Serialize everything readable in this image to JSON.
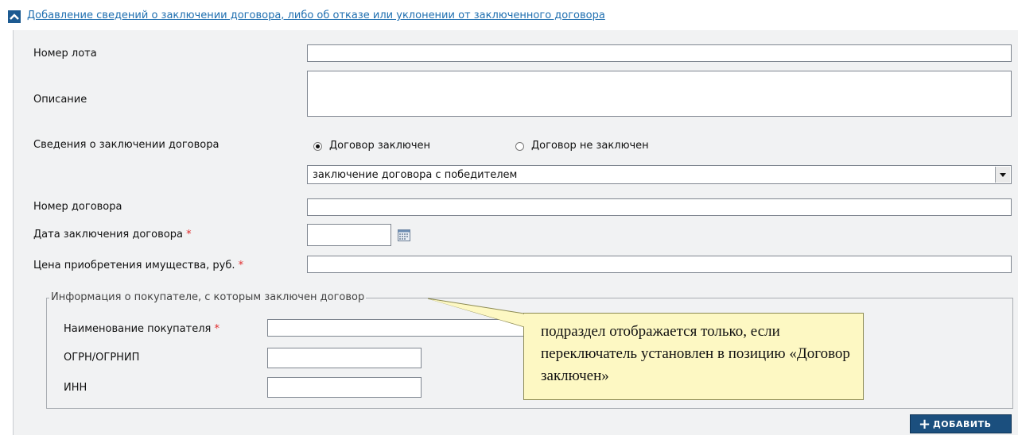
{
  "header": {
    "title": "Добавление сведений о заключении договора, либо об отказе или уклонении от заключенного договора"
  },
  "form": {
    "lot_number_label": "Номер лота",
    "description_label": "Описание",
    "contract_info_label": "Сведения о заключении договора",
    "radio_concluded": "Договор заключен",
    "radio_not_concluded": "Договор не заключен",
    "radio_selected": "Договор заключен",
    "reason_select_value": "заключение договора с победителем",
    "contract_number_label": "Номер договора",
    "contract_date_label": "Дата заключения договора",
    "price_label": "Цена приобретения имущества, руб.",
    "required_mark": "*"
  },
  "buyer_section": {
    "legend": "Информация о покупателе, с которым заключен договор",
    "name_label": "Наименование покупателя",
    "ogrn_label": "ОГРН/ОГРНИП",
    "inn_label": "ИНН"
  },
  "callout": {
    "text": "подраздел отображается только, если переключатель установлен в позицию «Договор заключен»"
  },
  "actions": {
    "add_label": "ДОБАВИТЬ"
  },
  "icons": {
    "collapse": "chevron-up-icon",
    "calendar": "calendar-icon",
    "add": "plus-icon"
  },
  "colors": {
    "link": "#1f6fb0",
    "button": "#1b4f7e",
    "required": "#e0292a",
    "callout_bg": "#fdf8c3"
  }
}
